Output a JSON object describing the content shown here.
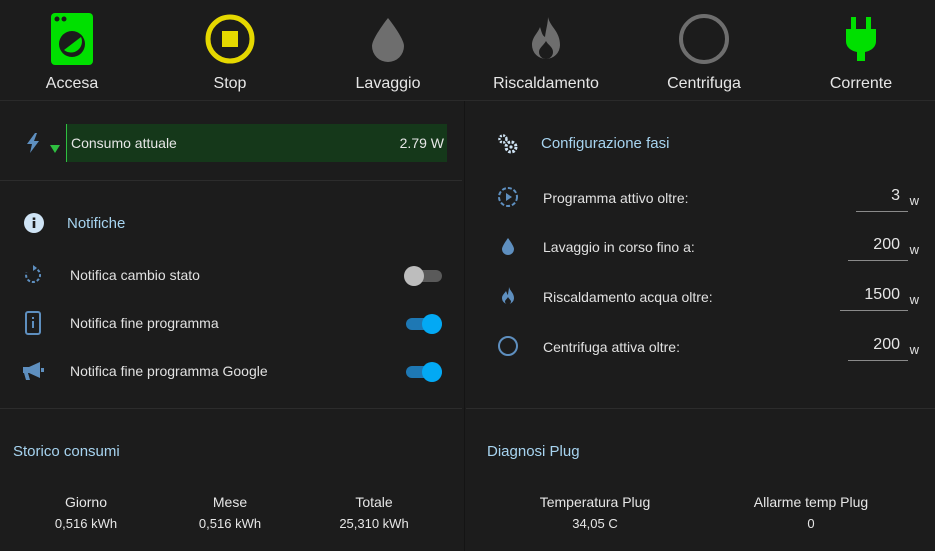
{
  "status_bar": {
    "tiles": [
      {
        "label": "Accesa",
        "icon": "washing-machine-icon",
        "color": "#00e000"
      },
      {
        "label": "Stop",
        "icon": "stop-circle-icon",
        "color": "#e5d800"
      },
      {
        "label": "Lavaggio",
        "icon": "water-drop-icon",
        "color": "#6e6e6e"
      },
      {
        "label": "Riscaldamento",
        "icon": "fire-icon",
        "color": "#6e6e6e"
      },
      {
        "label": "Centrifuga",
        "icon": "circle-outline-icon",
        "color": "#6e6e6e"
      },
      {
        "label": "Corrente",
        "icon": "power-plug-icon",
        "color": "#00e000"
      }
    ]
  },
  "consumption": {
    "icon": "flash-icon",
    "trend_icon": "triangle-down-icon",
    "label": "Consumo attuale",
    "value": "2.79 W",
    "bar_color": "#15381a"
  },
  "notifications": {
    "title": "Notifiche",
    "title_icon": "info-icon",
    "items": [
      {
        "label": "Notifica cambio stato",
        "icon": "restart-icon",
        "enabled": false
      },
      {
        "label": "Notifica fine programma",
        "icon": "cellphone-info-icon",
        "enabled": true
      },
      {
        "label": "Notifica fine programma Google",
        "icon": "bullhorn-icon",
        "enabled": true
      }
    ]
  },
  "phases": {
    "title": "Configurazione fasi",
    "title_icon": "cogs-icon",
    "items": [
      {
        "label": "Programma attivo oltre:",
        "icon": "play-circle-dashed-icon",
        "value": "3",
        "unit": "w"
      },
      {
        "label": "Lavaggio in corso fino a:",
        "icon": "water-drop-icon",
        "value": "200",
        "unit": "w"
      },
      {
        "label": "Riscaldamento acqua oltre:",
        "icon": "fire-icon",
        "value": "1500",
        "unit": "w"
      },
      {
        "label": "Centrifuga attiva oltre:",
        "icon": "circle-outline-icon",
        "value": "200",
        "unit": "w"
      }
    ]
  },
  "history": {
    "title": "Storico consumi",
    "stats": [
      {
        "name": "Giorno",
        "value": "0,516 kWh"
      },
      {
        "name": "Mese",
        "value": "0,516 kWh"
      },
      {
        "name": "Totale",
        "value": "25,310 kWh"
      }
    ]
  },
  "diagnostics": {
    "title": "Diagnosi Plug",
    "stats": [
      {
        "name": "Temperatura Plug",
        "value": "34,05 C"
      },
      {
        "name": "Allarme temp Plug",
        "value": "0"
      }
    ]
  },
  "colors": {
    "accent": "#a7d4f0",
    "icon_blue": "#5e8fbf",
    "toggle_on": "#03a9f4"
  }
}
